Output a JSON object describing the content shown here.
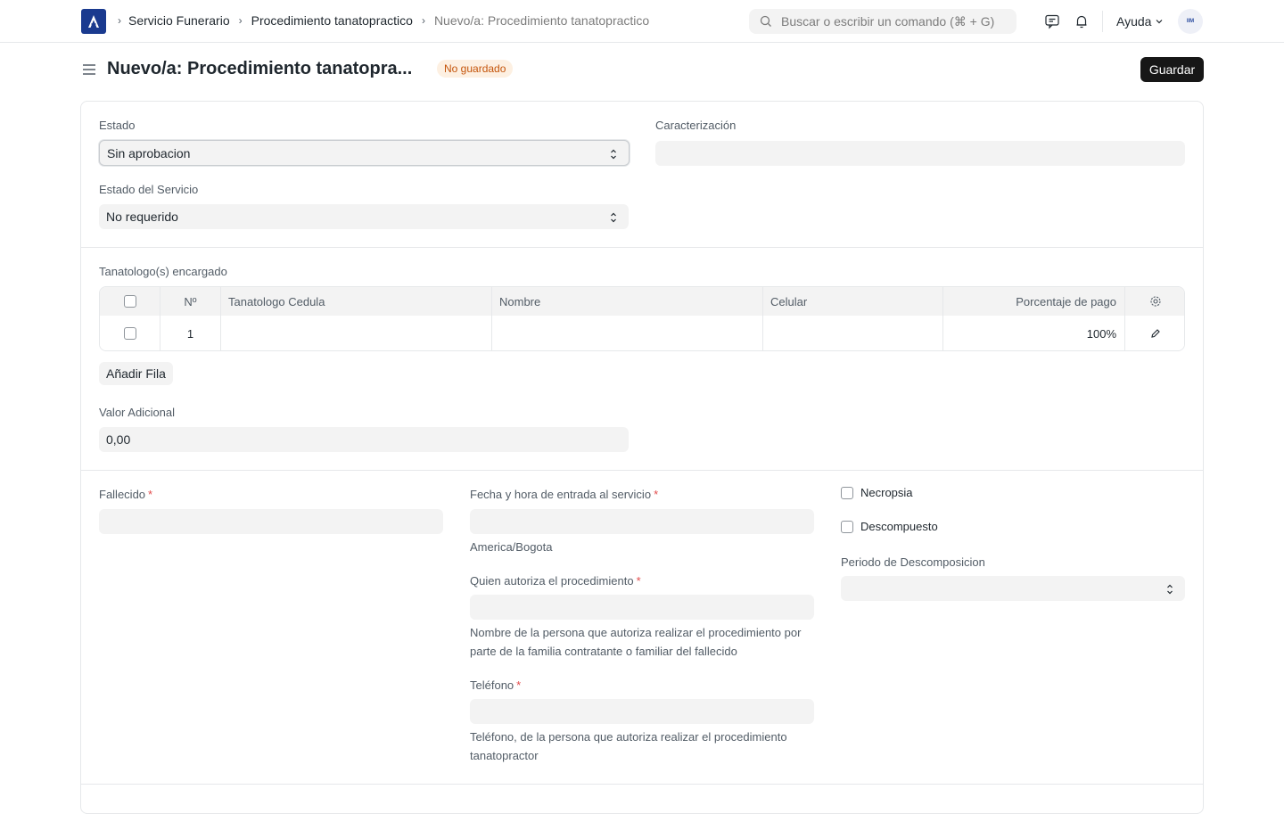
{
  "navbar": {
    "breadcrumbs": [
      "Servicio Funerario",
      "Procedimiento tanatopractico",
      "Nuevo/a: Procedimiento tanatopractico"
    ],
    "search_placeholder": "Buscar o escribir un comando (⌘ + G)",
    "help_label": "Ayuda",
    "avatar_text": "IIM"
  },
  "page": {
    "title": "Nuevo/a: Procedimiento tanatopra...",
    "status_badge": "No guardado",
    "save_label": "Guardar"
  },
  "section1": {
    "estado_label": "Estado",
    "estado_value": "Sin aprobacion",
    "caracterizacion_label": "Caracterización",
    "caracterizacion_value": "",
    "estado_servicio_label": "Estado del Servicio",
    "estado_servicio_value": "No requerido"
  },
  "section2": {
    "table_label": "Tanatologo(s) encargado",
    "columns": [
      "Nº",
      "Tanatologo Cedula",
      "Nombre",
      "Celular",
      "Porcentaje de pago"
    ],
    "rows": [
      {
        "no": "1",
        "cedula": "",
        "nombre": "",
        "celular": "",
        "porcentaje": "100%"
      }
    ],
    "add_row_label": "Añadir Fila",
    "valor_label": "Valor Adicional",
    "valor_value": "0,00"
  },
  "section3": {
    "fallecido_label": "Fallecido",
    "fecha_label": "Fecha y hora de entrada al servicio",
    "timezone": "America/Bogota",
    "autoriza_label": "Quien autoriza el procedimiento",
    "autoriza_help": "Nombre de la persona que autoriza realizar el procedimiento por parte de la familia contratante o familiar del fallecido",
    "telefono_label": "Teléfono",
    "telefono_help": "Teléfono, de la persona que autoriza realizar el procedimiento tanatopractor",
    "necropsia_label": "Necropsia",
    "descompuesto_label": "Descompuesto",
    "periodo_label": "Periodo de Descomposicion"
  }
}
